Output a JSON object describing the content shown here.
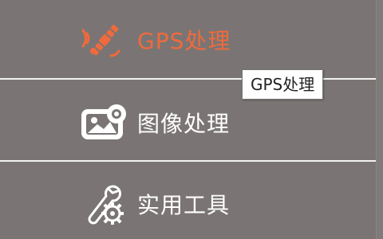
{
  "menu": {
    "items": [
      {
        "label": "GPS处理",
        "icon": "satellite-icon",
        "active": true
      },
      {
        "label": "图像处理",
        "icon": "image-icon",
        "active": false
      },
      {
        "label": "实用工具",
        "icon": "tools-icon",
        "active": false
      }
    ]
  },
  "tooltip": {
    "text": "GPS处理"
  },
  "colors": {
    "background": "#7a7574",
    "active_accent": "#ef6a3c",
    "text": "#ffffff",
    "divider": "#f2f2f2"
  }
}
